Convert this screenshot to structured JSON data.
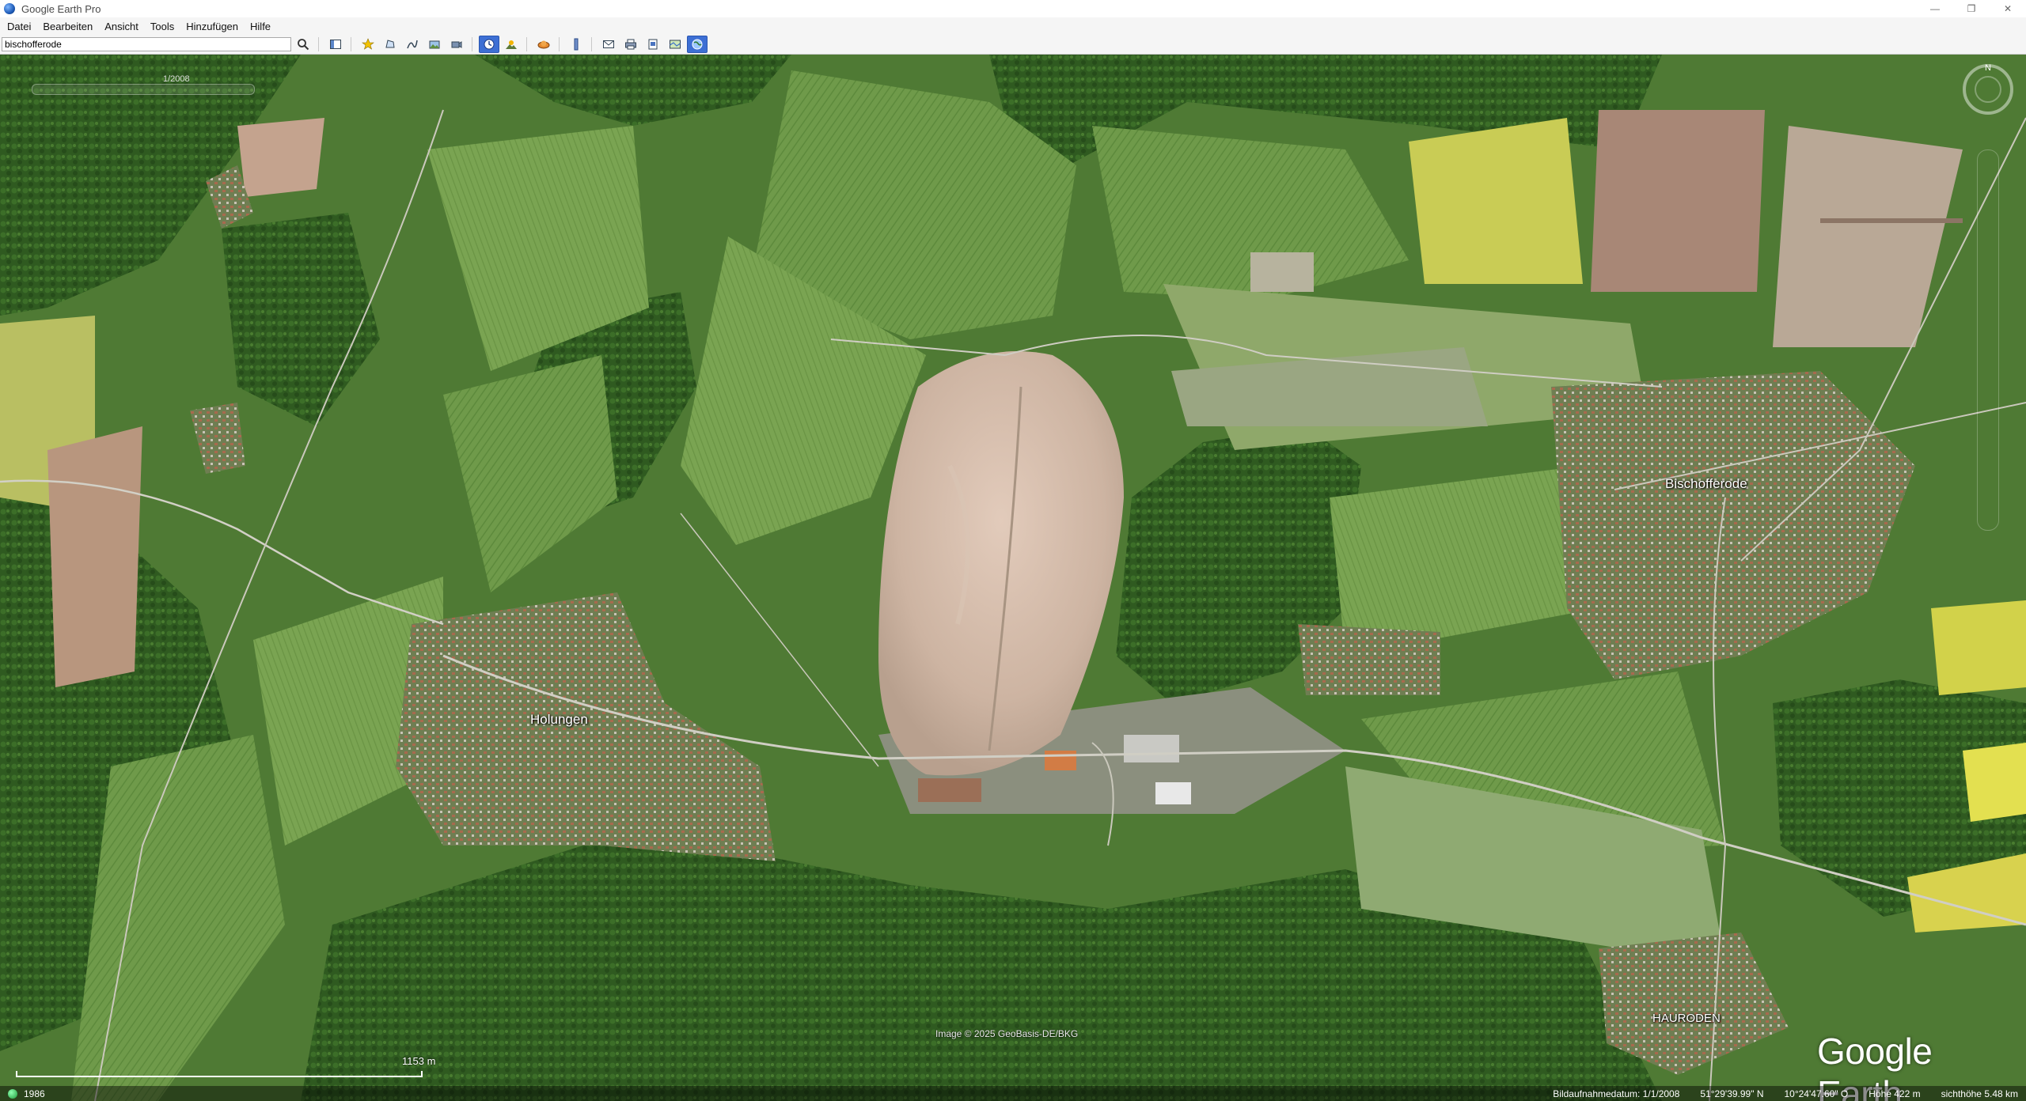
{
  "window": {
    "title": "Google Earth Pro",
    "controls": [
      "—",
      "❐",
      "✕"
    ]
  },
  "menu": {
    "items": [
      "Datei",
      "Bearbeiten",
      "Ansicht",
      "Tools",
      "Hinzufügen",
      "Hilfe"
    ]
  },
  "search": {
    "value": "bischofferode"
  },
  "toolbar": {
    "buttons": [
      "sidebar-toggle",
      "add-placemark",
      "add-polygon",
      "add-path",
      "add-image-overlay",
      "record-tour",
      "historical-imagery",
      "sunlight",
      "switch-planet",
      "ruler",
      "email",
      "print",
      "save-image",
      "view-in-maps",
      "earth-view"
    ]
  },
  "map": {
    "places": [
      "Holungen",
      "Bischofferode",
      "HAURODEN"
    ],
    "tour_date": "1/2008",
    "image_credit": "Image © 2025 GeoBasis-DE/BKG",
    "scale": "1153 m",
    "logo": "Google Earth"
  },
  "status": {
    "left": "1986",
    "date": "Bildaufnahmedatum: 1/1/2008",
    "lat": "51°29'39.99\" N",
    "lon": "10°24'47.60\" O",
    "elevation": "Höhe   422 m",
    "eye_alt": "sichthöhe   5.48 km"
  },
  "colors": {
    "forest": "#2f5a20",
    "field_light": "#6f9a4a",
    "field_yellow": "#c9cc55",
    "spoil_heap": "#cdb4a2",
    "village": "#8a6a55",
    "active_button": "#3d6fd4"
  }
}
